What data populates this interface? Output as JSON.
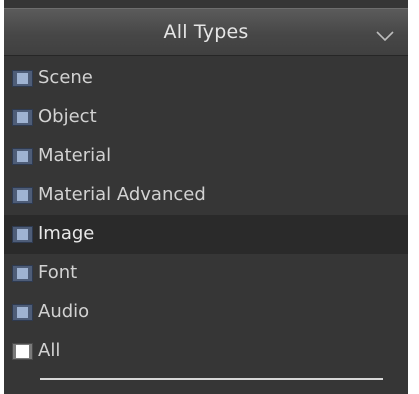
{
  "dropdown": {
    "selected_label": "All Types",
    "chevron_icon": "chevron-down-icon"
  },
  "items": [
    {
      "label": "Scene",
      "checked": false
    },
    {
      "label": "Object",
      "checked": false
    },
    {
      "label": "Material",
      "checked": false
    },
    {
      "label": "Material Advanced",
      "checked": false
    },
    {
      "label": "Image",
      "checked": false,
      "highlighted": true
    },
    {
      "label": "Font",
      "checked": false
    },
    {
      "label": "Audio",
      "checked": false
    },
    {
      "label": "All",
      "checked": true
    }
  ],
  "colors": {
    "frame": "#363636",
    "highlight": "#2a2a2a",
    "checkbox_off": "#8ea6c8",
    "checkbox_on": "#ffffff",
    "text": "#d2d2d2"
  }
}
